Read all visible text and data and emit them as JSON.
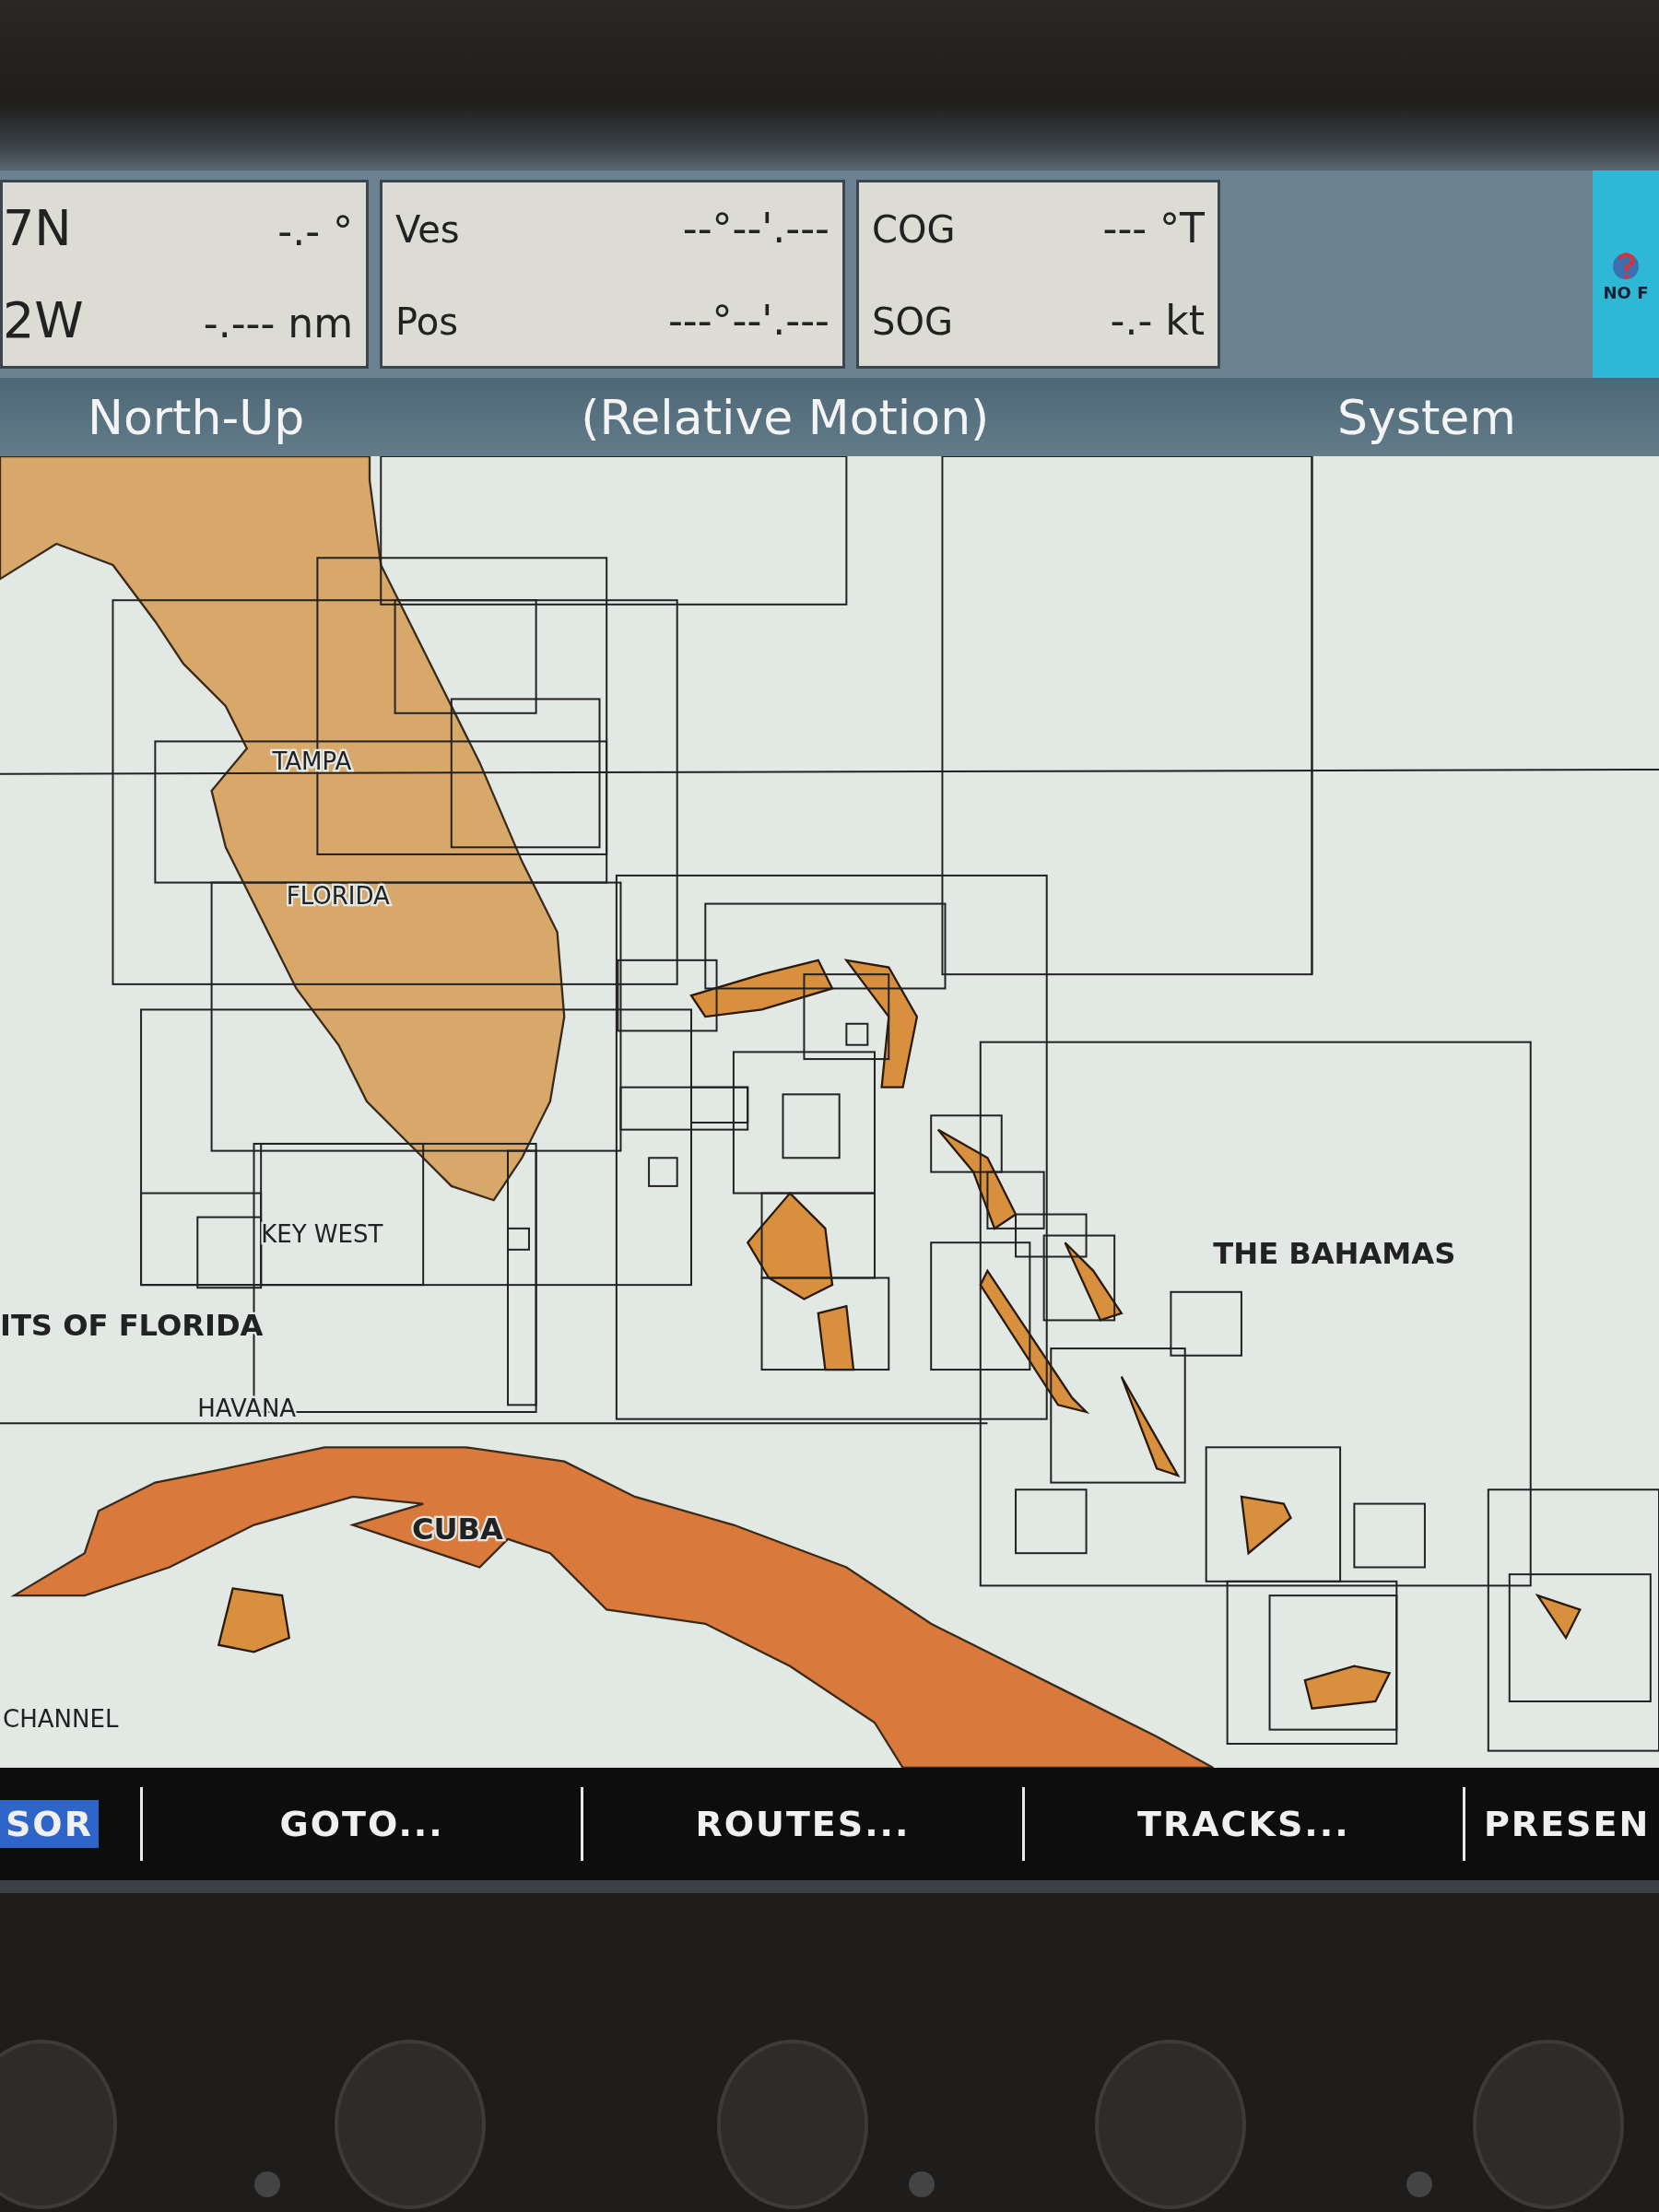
{
  "data_bar": {
    "panels": [
      {
        "rows": [
          {
            "label": "7N",
            "value": "-.- °"
          },
          {
            "label": "2W",
            "value": "-.--- nm"
          }
        ]
      },
      {
        "rows": [
          {
            "label": "Ves",
            "value": "--°--'.---"
          },
          {
            "label": "Pos",
            "value": "---°--'.---"
          }
        ]
      },
      {
        "rows": [
          {
            "label": "COG",
            "value": "--- °T"
          },
          {
            "label": "SOG",
            "value": "-.- kt"
          }
        ]
      }
    ],
    "fix_status": "NO F"
  },
  "mode_bar": {
    "orientation": "North-Up",
    "motion": "(Relative Motion)",
    "menu": "System"
  },
  "map": {
    "labels": [
      {
        "text": "TAMPA",
        "kind": "city"
      },
      {
        "text": "FLORIDA",
        "kind": "city"
      },
      {
        "text": "KEY WEST",
        "kind": "city"
      },
      {
        "text": "ITS OF FLORIDA",
        "kind": "region"
      },
      {
        "text": "HAVANA",
        "kind": "city"
      },
      {
        "text": "CUBA",
        "kind": "region"
      },
      {
        "text": "THE BAHAMAS",
        "kind": "region"
      },
      {
        "text": "CHANNEL",
        "kind": "city"
      }
    ]
  },
  "softkeys": [
    {
      "label": "SOR",
      "selected": true
    },
    {
      "label": "GOTO...",
      "selected": false
    },
    {
      "label": "ROUTES...",
      "selected": false
    },
    {
      "label": "TRACKS...",
      "selected": false
    },
    {
      "label": "PRESEN",
      "selected": false
    }
  ]
}
